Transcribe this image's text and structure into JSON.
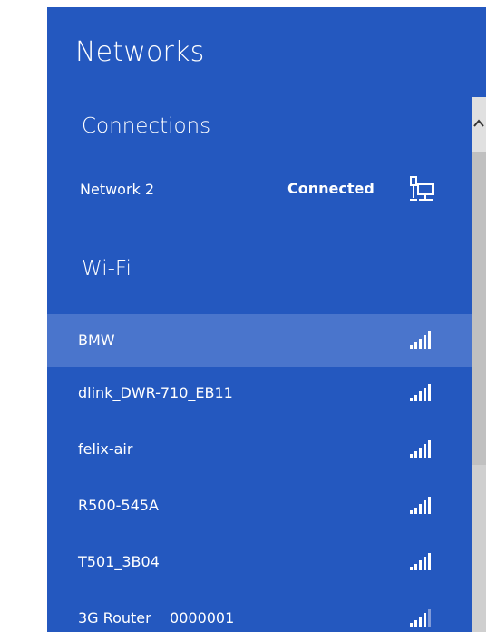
{
  "header": {
    "title": "Networks"
  },
  "connections": {
    "heading": "Connections",
    "items": [
      {
        "name": "Network 2",
        "status": "Connected",
        "icon": "wired-network-icon"
      }
    ]
  },
  "wifi": {
    "heading": "Wi-Fi",
    "selected": "BMW",
    "networks": [
      {
        "name": "BMW",
        "signal_bars": 5
      },
      {
        "name": "dlink_DWR-710_EB11",
        "signal_bars": 5
      },
      {
        "name": "felix-air",
        "signal_bars": 5
      },
      {
        "name": "R500-545A",
        "signal_bars": 5
      },
      {
        "name": "T501_3B04",
        "signal_bars": 5
      },
      {
        "name": "3G Router    0000001",
        "signal_bars": 4
      }
    ]
  },
  "colors": {
    "pane": "#2458BF",
    "selected_row": "#4A75CC",
    "text": "#ffffff",
    "scrollbar_track": "#cfcfcf"
  }
}
